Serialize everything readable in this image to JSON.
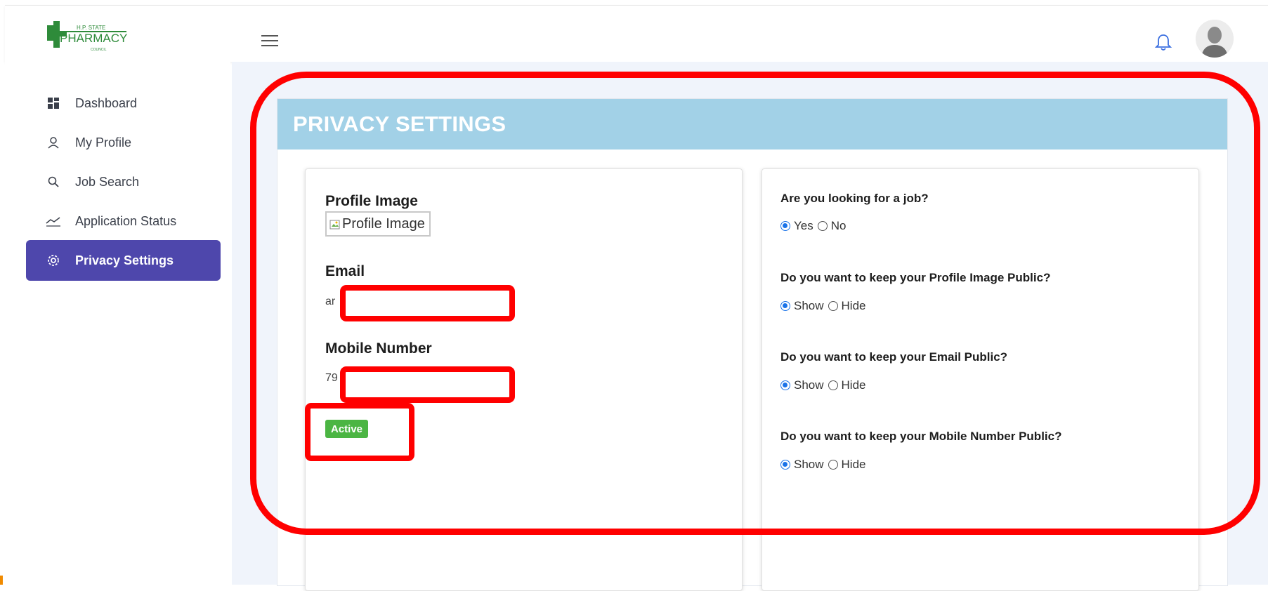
{
  "header": {
    "logo_text_small": "H.P. STATE",
    "logo_text_main": "PHARMACY",
    "logo_text_sub": "COUNCIL",
    "menu_icon": "hamburger-icon",
    "notification_icon": "bell-icon",
    "avatar_icon": "user-avatar"
  },
  "sidebar": {
    "items": [
      {
        "label": "Dashboard",
        "icon": "dashboard-icon"
      },
      {
        "label": "My Profile",
        "icon": "user-icon"
      },
      {
        "label": "Job Search",
        "icon": "search-icon"
      },
      {
        "label": "Application Status",
        "icon": "trend-icon"
      },
      {
        "label": "Privacy Settings",
        "icon": "gear-icon",
        "active": true
      }
    ]
  },
  "page": {
    "title": "PRIVACY SETTINGS"
  },
  "profile": {
    "image_label": "Profile Image",
    "image_alt": "Profile Image",
    "email_label": "Email",
    "email_value": "ar",
    "mobile_label": "Mobile Number",
    "mobile_value": "79",
    "status_badge": "Active"
  },
  "privacy": {
    "questions": [
      {
        "text": "Are you looking for a job?",
        "options": [
          "Yes",
          "No"
        ],
        "selected": "Yes"
      },
      {
        "text": "Do you want to keep your Profile Image Public?",
        "options": [
          "Show",
          "Hide"
        ],
        "selected": "Show"
      },
      {
        "text": "Do you want to keep your Email Public?",
        "options": [
          "Show",
          "Hide"
        ],
        "selected": "Show"
      },
      {
        "text": "Do you want to keep your Mobile Number Public?",
        "options": [
          "Show",
          "Hide"
        ],
        "selected": "Show"
      }
    ]
  },
  "colors": {
    "sidebar_active": "#4e47ac",
    "header_band": "#a2d1e7",
    "badge": "#4bb543",
    "annotation": "#ff0000",
    "radio_selected": "#1a73e8"
  }
}
